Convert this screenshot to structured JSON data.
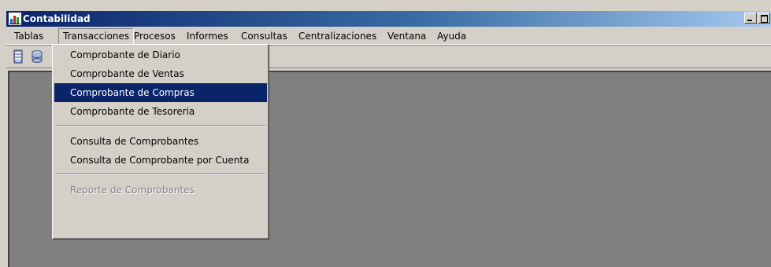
{
  "window": {
    "title": "Contabilidad"
  },
  "menubar": {
    "items": [
      "Tablas",
      "Transacciones",
      "Procesos",
      "Informes",
      "Consultas",
      "Centralizaciones",
      "Ventana",
      "Ayuda"
    ],
    "active": "Transacciones"
  },
  "toolbar": {
    "icons": [
      "document-stack-icon",
      "database-icon"
    ]
  },
  "dropdown": {
    "group1": [
      "Comprobante de Diario",
      "Comprobante de Ventas",
      "Comprobante de Compras",
      "Comprobante de Tesoreria"
    ],
    "group2": [
      "Consulta de Comprobantes",
      "Consulta de Comprobante por Cuenta"
    ],
    "group3": [
      "Reporte de Comprobantes"
    ],
    "selected": "Comprobante de Compras",
    "disabled": "Reporte de Comprobantes"
  },
  "colors": {
    "title_bar_start": "#0a246a",
    "title_bar_end": "#a6caf0",
    "face": "#d4d0c8",
    "workspace": "#808080",
    "selection": "#0a246a"
  }
}
